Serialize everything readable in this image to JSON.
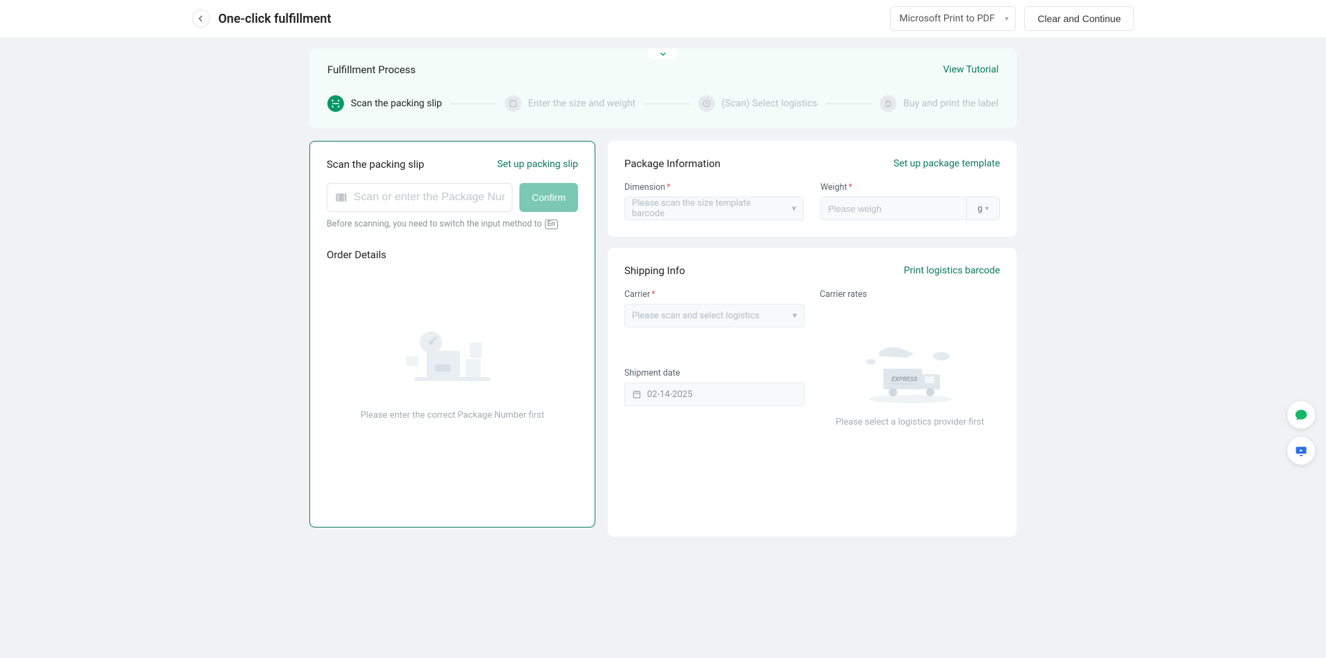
{
  "header": {
    "title": "One-click fulfillment",
    "printer": "Microsoft Print to PDF",
    "clear_btn": "Clear and Continue"
  },
  "process": {
    "title": "Fulfillment Process",
    "tutorial_link": "View Tutorial",
    "steps": [
      {
        "label": "Scan the packing slip",
        "active": true
      },
      {
        "label": "Enter the size and weight",
        "active": false
      },
      {
        "label": "(Scan)  Select logistics",
        "active": false
      },
      {
        "label": "Buy and print the label",
        "active": false
      }
    ]
  },
  "scan_card": {
    "title": "Scan the packing slip",
    "setup_link": "Set up packing slip",
    "input_placeholder": "Scan or enter the Package Numbe",
    "confirm_btn": "Confirm",
    "hint_prefix": "Before scanning, you need to switch the input method to",
    "hint_badge": "En",
    "order_details_title": "Order Details",
    "empty_text": "Please enter the correct Package Number first"
  },
  "package_card": {
    "title": "Package Information",
    "template_link": "Set up package template",
    "dimension_label": "Dimension",
    "dimension_placeholder": "Please scan the size template barcode",
    "weight_label": "Weight",
    "weight_placeholder": "Please weigh",
    "weight_unit": "g"
  },
  "shipping_card": {
    "title": "Shipping Info",
    "barcode_link": "Print logistics barcode",
    "carrier_label": "Carrier",
    "carrier_placeholder": "Please scan and select logistics",
    "shipment_date_label": "Shipment date",
    "shipment_date_value": "02-14-2025",
    "rates_label": "Carrier rates",
    "rates_empty": "Please select a logistics provider first"
  }
}
